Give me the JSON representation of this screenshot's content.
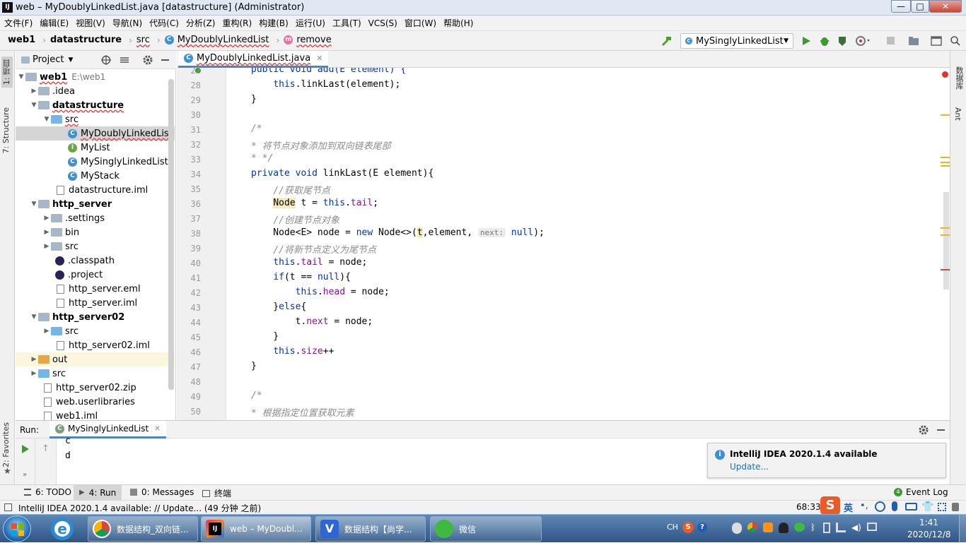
{
  "window": {
    "title": "web – MyDoublyLinkedList.java [datastructure] (Administrator)",
    "minimize": "—",
    "maximize": "□",
    "close": "✕"
  },
  "menu": [
    "文件(F)",
    "编辑(E)",
    "视图(V)",
    "导航(N)",
    "代码(C)",
    "分析(Z)",
    "重构(R)",
    "构建(B)",
    "运行(U)",
    "工具(T)",
    "VCS(S)",
    "窗口(W)",
    "帮助(H)"
  ],
  "breadcrumb": {
    "project": "web1",
    "module": "datastructure",
    "folder": "src",
    "file": "MyDoublyLinkedList",
    "method": "remove"
  },
  "run_config": "MySinglyLinkedList",
  "left_tabs": {
    "project": "1: 项目",
    "structure": "7: Structure",
    "favorites": "2: Favorites"
  },
  "right_tabs": {
    "database": "数据库",
    "ant": "Ant"
  },
  "project_panel": {
    "title": "Project",
    "tree": [
      {
        "label": "web1",
        "path": "E:\\web1"
      },
      {
        "label": ".idea"
      },
      {
        "label": "datastructure"
      },
      {
        "label": "src"
      },
      {
        "label": "MyDoublyLinkedList"
      },
      {
        "label": "MyList"
      },
      {
        "label": "MySinglyLinkedList"
      },
      {
        "label": "MyStack"
      },
      {
        "label": "datastructure.iml"
      },
      {
        "label": "http_server"
      },
      {
        "label": ".settings"
      },
      {
        "label": "bin"
      },
      {
        "label": "src"
      },
      {
        "label": ".classpath"
      },
      {
        "label": ".project"
      },
      {
        "label": "http_server.eml"
      },
      {
        "label": "http_server.iml"
      },
      {
        "label": "http_server02"
      },
      {
        "label": "src"
      },
      {
        "label": "http_server02.iml"
      },
      {
        "label": "out"
      },
      {
        "label": "src"
      },
      {
        "label": "http_server02.zip"
      },
      {
        "label": "web.userlibraries"
      },
      {
        "label": "web1.iml"
      }
    ]
  },
  "editor": {
    "tab": "MyDoublyLinkedList.java",
    "lines": [
      {
        "n": "27",
        "segs": [
          {
            "t": "public void add(E element) {",
            "c": "kw"
          }
        ]
      },
      {
        "n": "28",
        "segs": [
          {
            "t": "    "
          },
          {
            "t": "this",
            "c": "kw"
          },
          {
            "t": ".linkLast(element);"
          }
        ]
      },
      {
        "n": "29",
        "segs": [
          {
            "t": "}"
          }
        ]
      },
      {
        "n": "30",
        "segs": []
      },
      {
        "n": "31",
        "segs": [
          {
            "t": "/*",
            "c": "cm"
          }
        ]
      },
      {
        "n": "32",
        "segs": [
          {
            "t": "* 将节点对象添加到双向链表尾部",
            "c": "cm"
          }
        ]
      },
      {
        "n": "33",
        "segs": [
          {
            "t": "* */",
            "c": "cm"
          }
        ]
      },
      {
        "n": "34",
        "segs": [
          {
            "t": "private void ",
            "c": "kw"
          },
          {
            "t": "linkLast(E element){"
          }
        ]
      },
      {
        "n": "35",
        "segs": [
          {
            "t": "    "
          },
          {
            "t": "//获取尾节点",
            "c": "cm"
          }
        ]
      },
      {
        "n": "36",
        "segs": [
          {
            "t": "    "
          },
          {
            "t": "Node",
            "c": "hl"
          },
          {
            "t": " t = "
          },
          {
            "t": "this",
            "c": "kw"
          },
          {
            "t": "."
          },
          {
            "t": "tail",
            "c": "fld"
          },
          {
            "t": ";"
          }
        ]
      },
      {
        "n": "37",
        "segs": [
          {
            "t": "    "
          },
          {
            "t": "//创建节点对象",
            "c": "cm"
          }
        ]
      },
      {
        "n": "38",
        "segs": [
          {
            "t": "    Node<E> node = "
          },
          {
            "t": "new ",
            "c": "kw"
          },
          {
            "t": "Node<>("
          },
          {
            "t": "t",
            "c": "hl"
          },
          {
            "t": ",element, "
          },
          {
            "t": "next:",
            "c": "hint"
          },
          {
            "t": " "
          },
          {
            "t": "null",
            "c": "kw"
          },
          {
            "t": ");"
          }
        ]
      },
      {
        "n": "39",
        "segs": [
          {
            "t": "    "
          },
          {
            "t": "//将新节点定义为尾节点",
            "c": "cm"
          }
        ]
      },
      {
        "n": "40",
        "segs": [
          {
            "t": "    "
          },
          {
            "t": "this",
            "c": "kw"
          },
          {
            "t": "."
          },
          {
            "t": "tail",
            "c": "fld"
          },
          {
            "t": " = node;"
          }
        ]
      },
      {
        "n": "41",
        "segs": [
          {
            "t": "    "
          },
          {
            "t": "if",
            "c": "kw"
          },
          {
            "t": "(t == "
          },
          {
            "t": "null",
            "c": "kw"
          },
          {
            "t": "){"
          }
        ]
      },
      {
        "n": "42",
        "segs": [
          {
            "t": "        "
          },
          {
            "t": "this",
            "c": "kw"
          },
          {
            "t": "."
          },
          {
            "t": "head",
            "c": "fld"
          },
          {
            "t": " = node;"
          }
        ]
      },
      {
        "n": "43",
        "segs": [
          {
            "t": "    }"
          },
          {
            "t": "else",
            "c": "kw"
          },
          {
            "t": "{"
          }
        ]
      },
      {
        "n": "44",
        "segs": [
          {
            "t": "        t."
          },
          {
            "t": "next",
            "c": "fld"
          },
          {
            "t": " = node;"
          }
        ]
      },
      {
        "n": "45",
        "segs": [
          {
            "t": "    }"
          }
        ]
      },
      {
        "n": "46",
        "segs": [
          {
            "t": "    "
          },
          {
            "t": "this",
            "c": "kw"
          },
          {
            "t": "."
          },
          {
            "t": "size",
            "c": "fld"
          },
          {
            "t": "++"
          }
        ]
      },
      {
        "n": "47",
        "segs": [
          {
            "t": "}"
          }
        ]
      },
      {
        "n": "48",
        "segs": []
      },
      {
        "n": "49",
        "segs": [
          {
            "t": "/*",
            "c": "cm"
          }
        ]
      },
      {
        "n": "50",
        "segs": [
          {
            "t": "* 根据指定位置获取元素",
            "c": "cm"
          }
        ]
      }
    ]
  },
  "run_panel": {
    "label": "Run:",
    "tab": "MySinglyLinkedList",
    "output": [
      "c",
      "d"
    ]
  },
  "notification": {
    "title": "IntelliJ IDEA 2020.1.4 available",
    "link": "Update..."
  },
  "tool_tabs": {
    "todo": "6: TODO",
    "run": "4: Run",
    "messages": "0: Messages",
    "terminal": "终端",
    "event_log": "Event Log"
  },
  "status": {
    "message": "IntelliJ IDEA 2020.1.4 available: // Update... (49 分钟 之前)",
    "position": "68:33"
  },
  "ime": {
    "lang": "英"
  },
  "taskbar": {
    "items": [
      "数据结构_双向链...",
      "web – MyDoubl...",
      "数据结构【尚学...",
      "微信"
    ],
    "lang": "CH",
    "time": "1:41",
    "date": "2020/12/8"
  }
}
